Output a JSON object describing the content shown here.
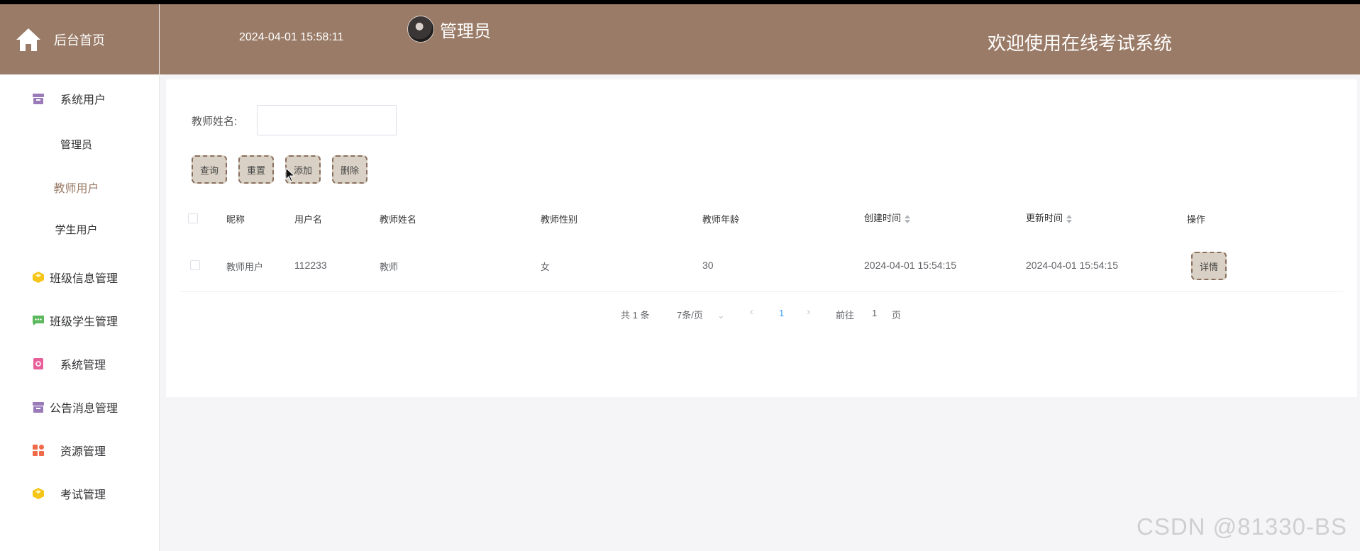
{
  "header": {
    "home_label": "后台首页",
    "datetime": "2024-04-01 15:58:11",
    "admin_name": "管理员",
    "welcome": "欢迎使用在线考试系统",
    "bg_color": "#9a7b67"
  },
  "sidebar": {
    "system_user": "系统用户",
    "sub_items": [
      "管理员",
      "教师用户",
      "学生用户"
    ],
    "active_sub": "教师用户",
    "items": [
      {
        "label": "班级信息管理",
        "icon": "cube-icon",
        "color": "#f5c518"
      },
      {
        "label": "班级学生管理",
        "icon": "message-icon",
        "color": "#5cb85c"
      },
      {
        "label": "系统管理",
        "icon": "settings-card-icon",
        "color": "#e8609a"
      },
      {
        "label": "公告消息管理",
        "icon": "archive-icon",
        "color": "#9a7ab8"
      },
      {
        "label": "资源管理",
        "icon": "grid-icon",
        "color": "#f06a4a"
      },
      {
        "label": "考试管理",
        "icon": "cube-icon",
        "color": "#f5c518"
      }
    ]
  },
  "search": {
    "label": "教师姓名:",
    "value": ""
  },
  "buttons": {
    "query": "查询",
    "reset": "重置",
    "add": "添加",
    "delete": "删除"
  },
  "table": {
    "headers": [
      "昵称",
      "用户名",
      "教师姓名",
      "教师性别",
      "教师年龄",
      "创建时间",
      "更新时间",
      "操作"
    ],
    "rows": [
      {
        "nickname": "教师用户",
        "username": "112233",
        "name": "教师",
        "gender": "女",
        "age": "30",
        "created": "2024-04-01 15:54:15",
        "updated": "2024-04-01 15:54:15",
        "action": "详情"
      }
    ]
  },
  "pagination": {
    "total": "共 1 条",
    "page_size": "7条/页",
    "current": "1",
    "goto_label": "前往",
    "goto_value": "1",
    "page_suffix": "页"
  },
  "watermark": "CSDN @81330-BS"
}
